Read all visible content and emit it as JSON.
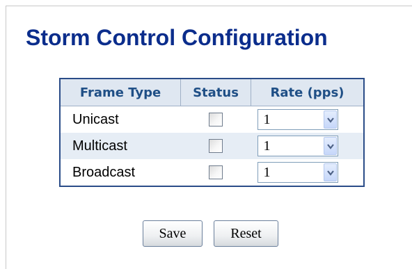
{
  "page": {
    "title": "Storm Control Configuration"
  },
  "table": {
    "headers": [
      "Frame Type",
      "Status",
      "Rate (pps)"
    ],
    "rows": [
      {
        "frame_type": "Unicast",
        "status_checked": false,
        "rate": "1"
      },
      {
        "frame_type": "Multicast",
        "status_checked": false,
        "rate": "1"
      },
      {
        "frame_type": "Broadcast",
        "status_checked": false,
        "rate": "1"
      }
    ]
  },
  "buttons": {
    "save_label": "Save",
    "reset_label": "Reset"
  },
  "icons": {
    "dropdown": "chevron-down-icon"
  },
  "colors": {
    "title": "#0b2d8c",
    "table_border": "#2a4c88",
    "header_bg": "#dfe7f1",
    "header_text": "#1f4f86",
    "alt_row_bg": "#e6edf5"
  }
}
